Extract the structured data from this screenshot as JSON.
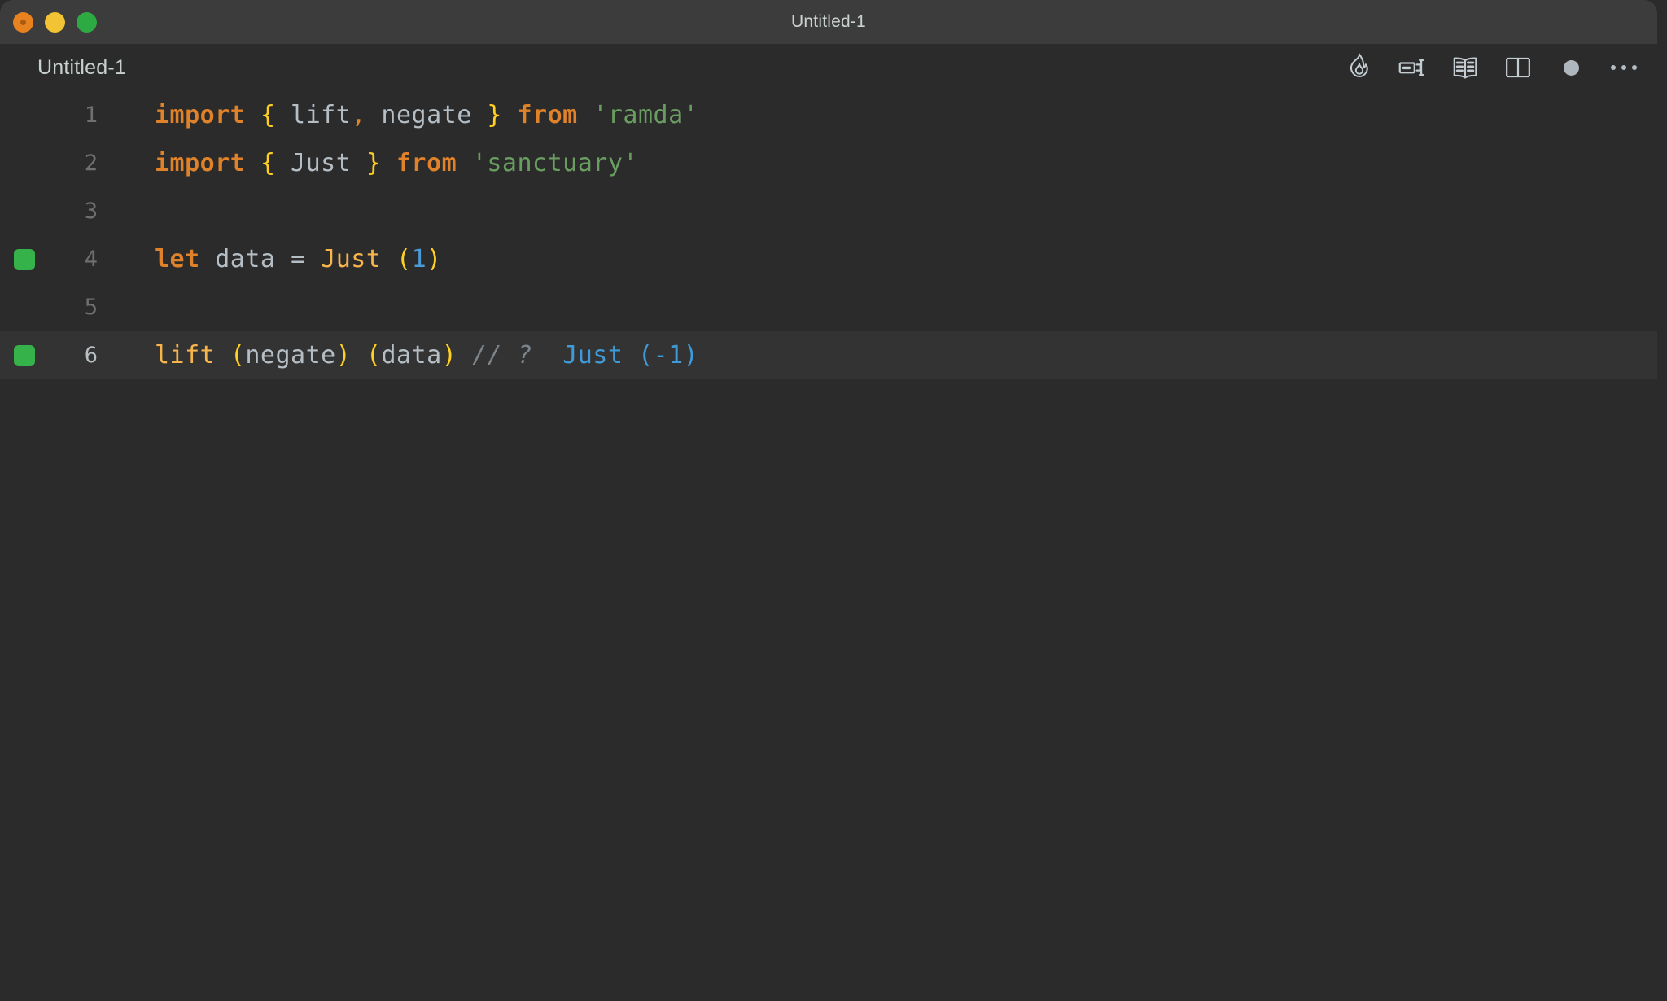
{
  "window": {
    "title": "Untitled-1",
    "traffic_lights": [
      {
        "name": "close",
        "color": "#e8821e"
      },
      {
        "name": "minimize",
        "color": "#f2c335"
      },
      {
        "name": "maximize",
        "color": "#2eaa42"
      }
    ]
  },
  "tabbar": {
    "tab_label": "Untitled-1",
    "actions": [
      {
        "name": "quokka-flame-icon",
        "label": "Quokka"
      },
      {
        "name": "open-changes-icon",
        "label": "Open Changes"
      },
      {
        "name": "open-preview-book-icon",
        "label": "Open Preview"
      },
      {
        "name": "split-editor-icon",
        "label": "Split Editor Right"
      },
      {
        "name": "unsaved-dot-icon",
        "label": "Unsaved changes"
      },
      {
        "name": "more-actions-icon",
        "label": "More Actions..."
      }
    ]
  },
  "editor": {
    "language": "javascript",
    "lines": [
      {
        "number": "1",
        "marker": false,
        "active": false,
        "tokens": [
          {
            "cls": "t-kw",
            "text": "import"
          },
          {
            "cls": "t-op",
            "text": " "
          },
          {
            "cls": "t-brace",
            "text": "{"
          },
          {
            "cls": "t-ident",
            "text": " lift"
          },
          {
            "cls": "t-punc",
            "text": ","
          },
          {
            "cls": "t-ident",
            "text": " negate "
          },
          {
            "cls": "t-brace",
            "text": "}"
          },
          {
            "cls": "t-op",
            "text": " "
          },
          {
            "cls": "t-kw",
            "text": "from"
          },
          {
            "cls": "t-op",
            "text": " "
          },
          {
            "cls": "t-str",
            "text": "'ramda'"
          }
        ]
      },
      {
        "number": "2",
        "marker": false,
        "active": false,
        "tokens": [
          {
            "cls": "t-kw",
            "text": "import"
          },
          {
            "cls": "t-op",
            "text": " "
          },
          {
            "cls": "t-brace",
            "text": "{"
          },
          {
            "cls": "t-ident",
            "text": " Just "
          },
          {
            "cls": "t-brace",
            "text": "}"
          },
          {
            "cls": "t-op",
            "text": " "
          },
          {
            "cls": "t-kw",
            "text": "from"
          },
          {
            "cls": "t-op",
            "text": " "
          },
          {
            "cls": "t-str",
            "text": "'sanctuary'"
          }
        ]
      },
      {
        "number": "3",
        "marker": false,
        "active": false,
        "tokens": []
      },
      {
        "number": "4",
        "marker": true,
        "active": false,
        "tokens": [
          {
            "cls": "t-kw",
            "text": "let"
          },
          {
            "cls": "t-ident",
            "text": " data "
          },
          {
            "cls": "t-op",
            "text": "="
          },
          {
            "cls": "t-op",
            "text": " "
          },
          {
            "cls": "t-fn",
            "text": "Just"
          },
          {
            "cls": "t-op",
            "text": " "
          },
          {
            "cls": "t-paren",
            "text": "("
          },
          {
            "cls": "t-num",
            "text": "1"
          },
          {
            "cls": "t-paren",
            "text": ")"
          }
        ]
      },
      {
        "number": "5",
        "marker": false,
        "active": false,
        "tokens": []
      },
      {
        "number": "6",
        "marker": true,
        "active": true,
        "tokens": [
          {
            "cls": "t-fn",
            "text": "lift"
          },
          {
            "cls": "t-op",
            "text": " "
          },
          {
            "cls": "t-paren",
            "text": "("
          },
          {
            "cls": "t-ident",
            "text": "negate"
          },
          {
            "cls": "t-paren",
            "text": ")"
          },
          {
            "cls": "t-op",
            "text": " "
          },
          {
            "cls": "t-paren",
            "text": "("
          },
          {
            "cls": "t-ident",
            "text": "data"
          },
          {
            "cls": "t-paren",
            "text": ")"
          },
          {
            "cls": "t-op",
            "text": " "
          },
          {
            "cls": "t-comment",
            "text": "// ?"
          },
          {
            "cls": "t-op",
            "text": "  "
          },
          {
            "cls": "t-output",
            "text": "Just (-1)"
          }
        ]
      }
    ]
  },
  "colors": {
    "window_background": "#2b2b2b",
    "titlebar_background": "#3c3c3c",
    "active_line_background": "#333333",
    "quokka_marker_green": "#35b34a",
    "keyword_orange": "#e0822a",
    "brace_yellow": "#ffd021",
    "string_green": "#6a9e61",
    "function_amber": "#f8b44c",
    "number_blue": "#4a9bd6",
    "output_blue": "#3f9bd8",
    "comment_gray": "#7d8489",
    "identifier_gray": "#b5bec4"
  }
}
